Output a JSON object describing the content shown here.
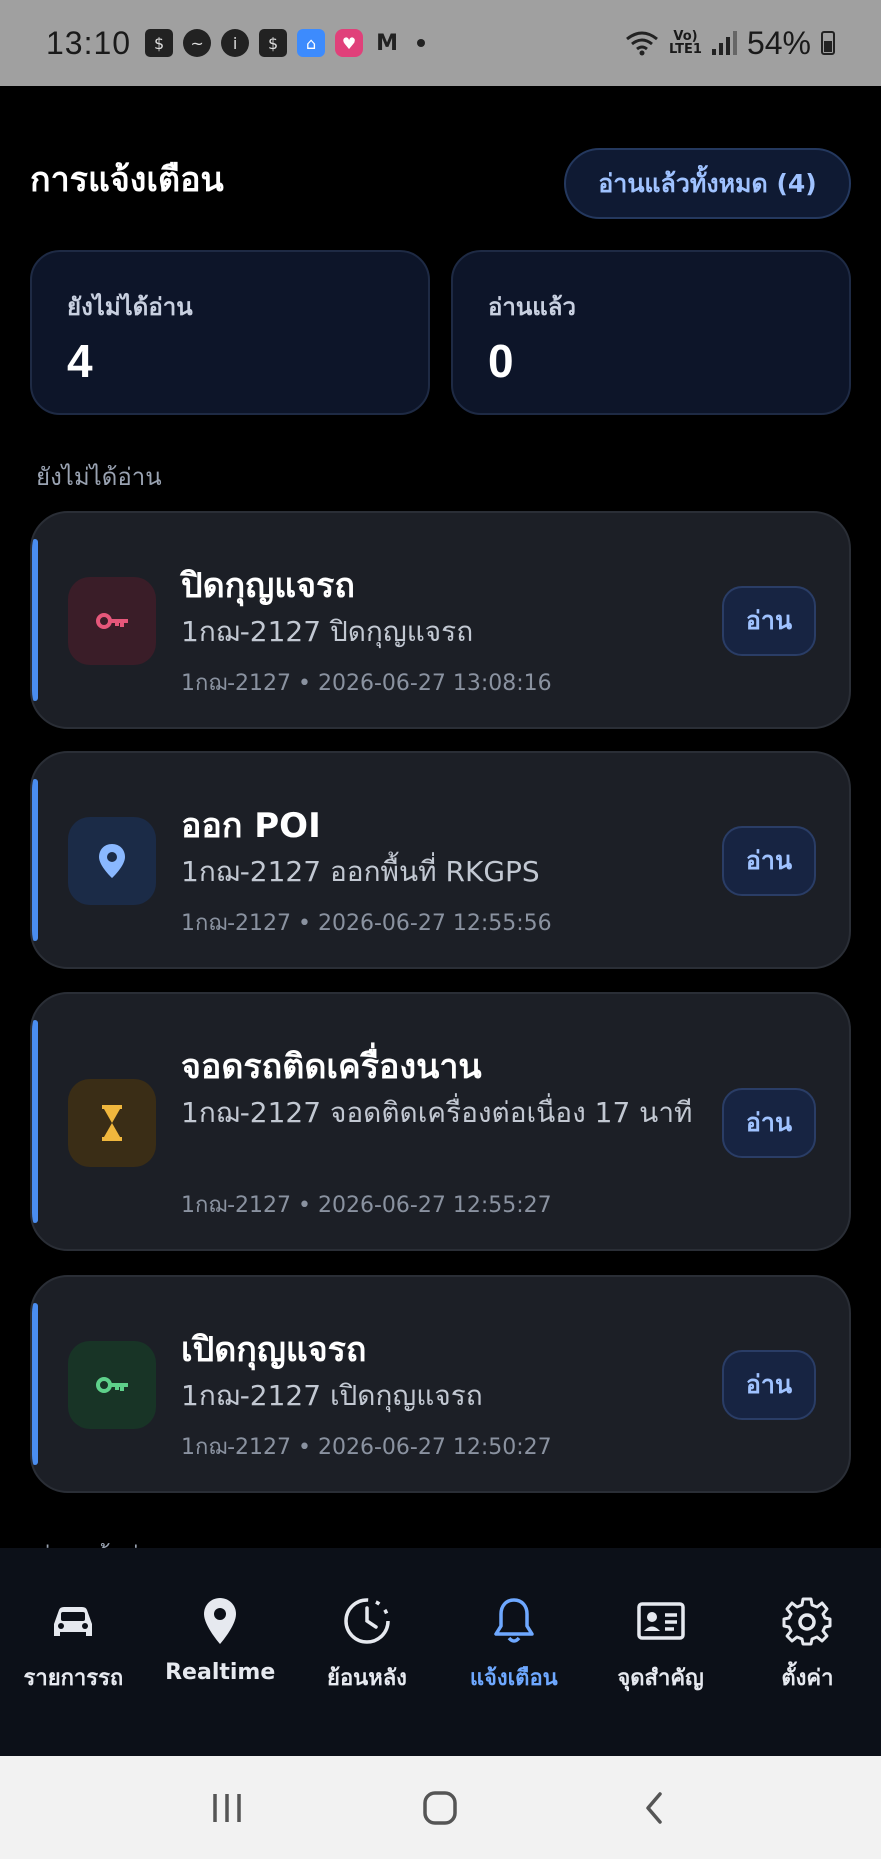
{
  "status_bar": {
    "time": "13:10",
    "battery": "54%",
    "network": "LTE1"
  },
  "header": {
    "title": "การแจ้งเตือน",
    "read_all_label": "อ่านแล้วทั้งหมด (4)"
  },
  "stats": {
    "unread_label": "ยังไม่ได้อ่าน",
    "unread_count": "4",
    "read_label": "อ่านแล้ว",
    "read_count": "0"
  },
  "sections": {
    "unread": "ยังไม่ได้อ่าน",
    "recent_read": "อ่านแล้วล่าสุด"
  },
  "notifications": [
    {
      "title": "ปิดกุญแจรถ",
      "description": "1กฌ-2127 ปิดกุญแจรถ",
      "meta": "1กฌ-2127 • 2026-06-27 13:08:16",
      "icon": "key-icon",
      "icon_color": "#e5577a",
      "icon_bg": "#3a1d28",
      "action_label": "อ่าน"
    },
    {
      "title": "ออก POI",
      "description": "1กฌ-2127 ออกพื้นที่ RKGPS",
      "meta": "1กฌ-2127 • 2026-06-27 12:55:56",
      "icon": "location-pin-icon",
      "icon_color": "#8ab8ff",
      "icon_bg": "#1b2b47",
      "action_label": "อ่าน"
    },
    {
      "title": "จอดรถติดเครื่องนาน",
      "description": "1กฌ-2127 จอดติดเครื่องต่อเนื่อง 17 นาที",
      "meta": "1กฌ-2127 • 2026-06-27 12:55:27",
      "icon": "hourglass-icon",
      "icon_color": "#f0b73d",
      "icon_bg": "#3a2d16",
      "action_label": "อ่าน"
    },
    {
      "title": "เปิดกุญแจรถ",
      "description": "1กฌ-2127 เปิดกุญแจรถ",
      "meta": "1กฌ-2127 • 2026-06-27 12:50:27",
      "icon": "key-icon",
      "icon_color": "#5ed08a",
      "icon_bg": "#183426",
      "action_label": "อ่าน"
    }
  ],
  "bottom_nav": [
    {
      "label": "รายการรถ",
      "icon": "car-icon",
      "active": false
    },
    {
      "label": "Realtime",
      "icon": "location-pin-icon",
      "active": false
    },
    {
      "label": "ย้อนหลัง",
      "icon": "history-clock-icon",
      "active": false
    },
    {
      "label": "แจ้งเตือน",
      "icon": "bell-icon",
      "active": true
    },
    {
      "label": "จุดสำคัญ",
      "icon": "id-card-icon",
      "active": false
    },
    {
      "label": "ตั้งค่า",
      "icon": "gear-icon",
      "active": false
    }
  ],
  "colors": {
    "accent": "#4a8df0",
    "active_nav": "#6ea8ff",
    "card_bg": "#1c1f26",
    "page_bg": "#000000"
  }
}
